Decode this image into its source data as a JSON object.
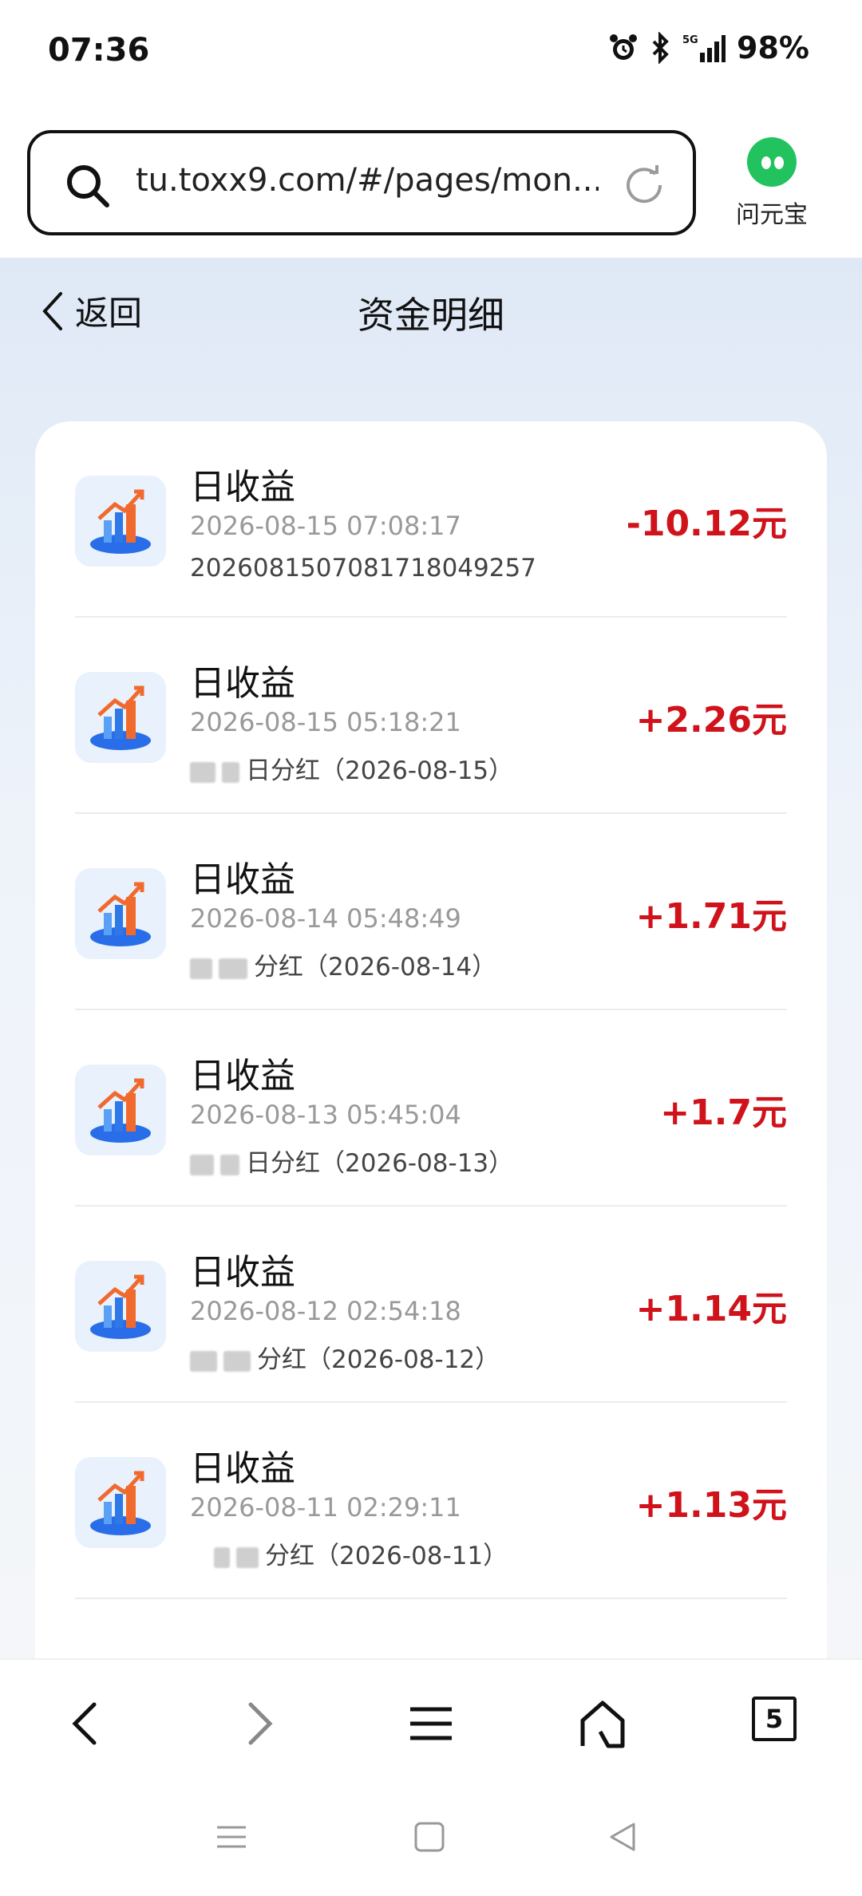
{
  "status": {
    "time": "07:36",
    "network": "5G",
    "battery": "98%"
  },
  "browser": {
    "url": "tu.toxx9.com/#/pages/mon...",
    "assistant_label": "问元宝",
    "tab_count": "5"
  },
  "header": {
    "back_label": "返回",
    "title": "资金明细"
  },
  "transactions": [
    {
      "title": "日收益",
      "time": "2026-08-15 07:08:17",
      "sub": "202608150708171804925​7",
      "amount": "-10.12元"
    },
    {
      "title": "日收益",
      "time": "2026-08-15 05:18:21",
      "sub": "日分红（2026-08-15）",
      "amount": "+2.26元"
    },
    {
      "title": "日收益",
      "time": "2026-08-14 05:48:49",
      "sub": "分红（2026-08-14）",
      "amount": "+1.71元"
    },
    {
      "title": "日收益",
      "time": "2026-08-13 05:45:04",
      "sub": "日分红（2026-08-13）",
      "amount": "+1.7元"
    },
    {
      "title": "日收益",
      "time": "2026-08-12 02:54:18",
      "sub": "分红（2026-08-12）",
      "amount": "+1.14元"
    },
    {
      "title": "日收益",
      "time": "2026-08-11 02:29:11",
      "sub": "分红（2026-08-11）",
      "amount": "+1.13元"
    }
  ],
  "colors": {
    "amount": "#d0121b",
    "accent_green": "#22c35e"
  }
}
